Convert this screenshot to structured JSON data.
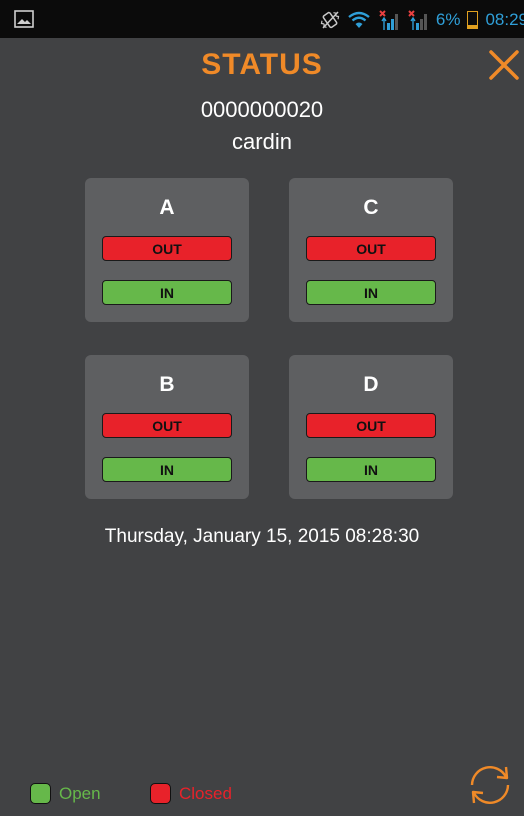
{
  "status_bar": {
    "battery": "6%",
    "time": "08:29"
  },
  "header": {
    "title": "STATUS"
  },
  "device": {
    "id": "0000000020",
    "name": "cardin"
  },
  "cards": [
    {
      "label": "A",
      "out_label": "OUT",
      "in_label": "IN"
    },
    {
      "label": "C",
      "out_label": "OUT",
      "in_label": "IN"
    },
    {
      "label": "B",
      "out_label": "OUT",
      "in_label": "IN"
    },
    {
      "label": "D",
      "out_label": "OUT",
      "in_label": "IN"
    }
  ],
  "timestamp": "Thursday, January 15, 2015 08:28:30",
  "legend": {
    "open_label": "Open",
    "closed_label": "Closed",
    "open_color": "#66b84a",
    "closed_color": "#e8222a"
  },
  "colors": {
    "accent": "#f08a28",
    "background": "#414244",
    "card": "#5e5f61",
    "status_text": "#2f9fd8"
  },
  "icons": {
    "close": "close-icon",
    "refresh": "refresh-icon",
    "gallery": "gallery-icon",
    "vibrate": "vibrate-icon",
    "wifi": "wifi-icon",
    "signal": "signal-icon"
  }
}
